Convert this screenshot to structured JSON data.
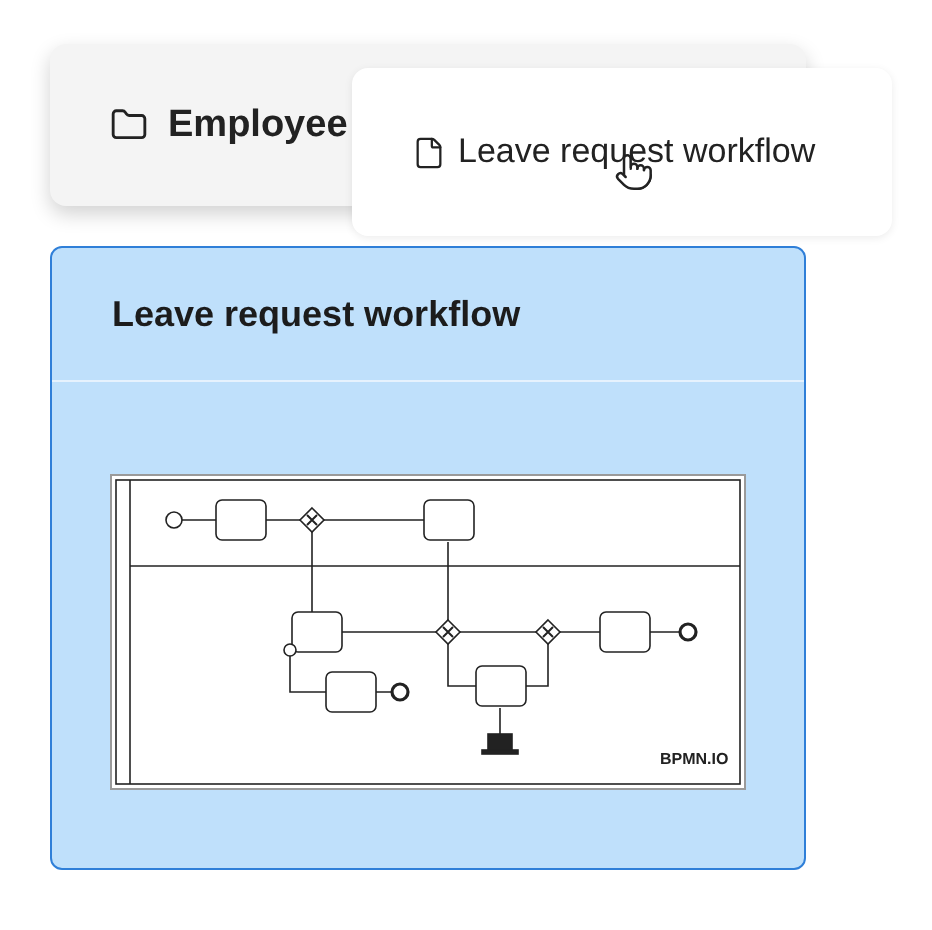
{
  "folder": {
    "name": "Employee"
  },
  "drag_preview": {
    "name": "Leave request workflow"
  },
  "cards": [
    {
      "title": "Leave request workflow",
      "selected": true,
      "logo": "BPMN.IO"
    }
  ]
}
